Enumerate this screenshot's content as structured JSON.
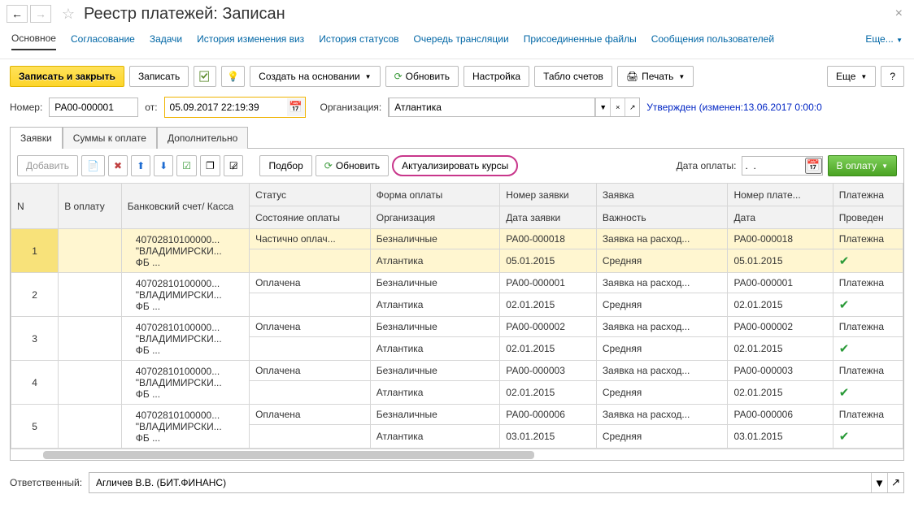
{
  "title": "Реестр платежей: Записан",
  "linkbar": {
    "main": "Основное",
    "items": [
      "Согласование",
      "Задачи",
      "История изменения виз",
      "История статусов",
      "Очередь трансляции",
      "Присоединенные файлы",
      "Сообщения пользователей"
    ],
    "more": "Еще..."
  },
  "toolbar1": {
    "save_close": "Записать и закрыть",
    "save": "Записать",
    "create_based": "Создать на основании",
    "refresh": "Обновить",
    "settings": "Настройка",
    "accounts_board": "Табло счетов",
    "print": "Печать",
    "more": "Еще",
    "help": "?"
  },
  "fields": {
    "number_lbl": "Номер:",
    "number": "РА00-000001",
    "from_lbl": "от:",
    "date": "05.09.2017 22:19:39",
    "org_lbl": "Организация:",
    "org": "Атлантика",
    "approved": "Утвержден (изменен:13.06.2017 0:00:0"
  },
  "tabs": {
    "requests": "Заявки",
    "sums": "Суммы к оплате",
    "extra": "Дополнительно"
  },
  "toolbar2": {
    "add": "Добавить",
    "select": "Подбор",
    "refresh": "Обновить",
    "update_rates": "Актуализировать курсы",
    "paydate_lbl": "Дата оплаты:",
    "paydate": ".  .",
    "to_pay": "В оплату"
  },
  "cols": {
    "n": "N",
    "topay": "В оплату",
    "acct": "Банковский счет/ Касса",
    "status": "Статус",
    "form": "Форма оплаты",
    "reqnum": "Номер заявки",
    "request": "Заявка",
    "paynum": "Номер плате...",
    "payment": "Платежна",
    "paystate": "Состояние оплаты",
    "org": "Организация",
    "reqdate": "Дата заявки",
    "priority": "Важность",
    "date": "Дата",
    "posted": "Проведен"
  },
  "rows": [
    {
      "n": "1",
      "acct1": "40702810100000...",
      "acct2": "\"ВЛАДИМИРСКИ...",
      "acct3": "ФБ ...",
      "status": "Частично оплач...",
      "form": "Безналичные",
      "reqnum": "РА00-000018",
      "request": "Заявка на расход...",
      "paynum": "РА00-000018",
      "payment": "Платежна",
      "org": "Атлантика",
      "reqdate": "05.01.2015",
      "priority": "Средняя",
      "date": "05.01.2015",
      "posted": true,
      "sel": true
    },
    {
      "n": "2",
      "acct1": "40702810100000...",
      "acct2": "\"ВЛАДИМИРСКИ...",
      "acct3": "ФБ ...",
      "status": "Оплачена",
      "form": "Безналичные",
      "reqnum": "РА00-000001",
      "request": "Заявка на расход...",
      "paynum": "РА00-000001",
      "payment": "Платежна",
      "org": "Атлантика",
      "reqdate": "02.01.2015",
      "priority": "Средняя",
      "date": "02.01.2015",
      "posted": true
    },
    {
      "n": "3",
      "acct1": "40702810100000...",
      "acct2": "\"ВЛАДИМИРСКИ...",
      "acct3": "ФБ ...",
      "status": "Оплачена",
      "form": "Безналичные",
      "reqnum": "РА00-000002",
      "request": "Заявка на расход...",
      "paynum": "РА00-000002",
      "payment": "Платежна",
      "org": "Атлантика",
      "reqdate": "02.01.2015",
      "priority": "Средняя",
      "date": "02.01.2015",
      "posted": true
    },
    {
      "n": "4",
      "acct1": "40702810100000...",
      "acct2": "\"ВЛАДИМИРСКИ...",
      "acct3": "ФБ ...",
      "status": "Оплачена",
      "form": "Безналичные",
      "reqnum": "РА00-000003",
      "request": "Заявка на расход...",
      "paynum": "РА00-000003",
      "payment": "Платежна",
      "org": "Атлантика",
      "reqdate": "02.01.2015",
      "priority": "Средняя",
      "date": "02.01.2015",
      "posted": true
    },
    {
      "n": "5",
      "acct1": "40702810100000...",
      "acct2": "\"ВЛАДИМИРСКИ...",
      "acct3": "ФБ ...",
      "status": "Оплачена",
      "form": "Безналичные",
      "reqnum": "РА00-000006",
      "request": "Заявка на расход...",
      "paynum": "РА00-000006",
      "payment": "Платежна",
      "org": "Атлантика",
      "reqdate": "03.01.2015",
      "priority": "Средняя",
      "date": "03.01.2015",
      "posted": true
    }
  ],
  "footer": {
    "resp_lbl": "Ответственный:",
    "resp": "Агличев В.В. (БИТ.ФИНАНС)"
  }
}
